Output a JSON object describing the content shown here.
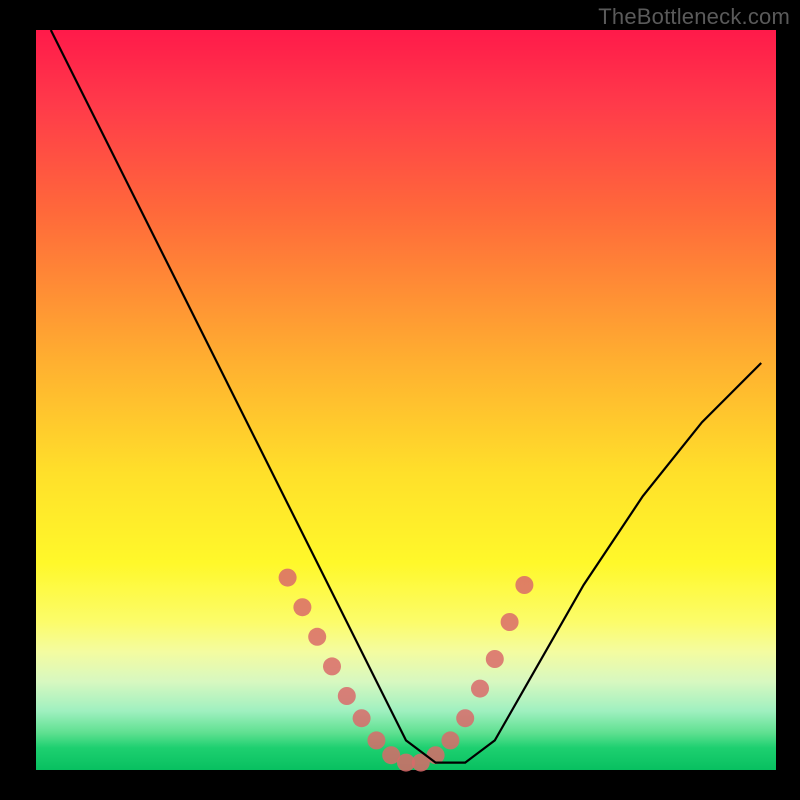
{
  "watermark": "TheBottleneck.com",
  "chart_data": {
    "type": "line",
    "title": "",
    "xlabel": "",
    "ylabel": "",
    "xlim": [
      0,
      100
    ],
    "ylim": [
      0,
      100
    ],
    "grid": false,
    "legend": false,
    "background_gradient": [
      "#ff1a4a",
      "#ffe02a",
      "#08c060"
    ],
    "series": [
      {
        "name": "bottleneck-curve",
        "color": "#000000",
        "x": [
          2,
          6,
          10,
          14,
          18,
          22,
          26,
          30,
          34,
          38,
          42,
          46,
          50,
          54,
          58,
          62,
          66,
          70,
          74,
          78,
          82,
          86,
          90,
          94,
          98
        ],
        "values": [
          100,
          92,
          84,
          76,
          68,
          60,
          52,
          44,
          36,
          28,
          20,
          12,
          4,
          1,
          1,
          4,
          11,
          18,
          25,
          31,
          37,
          42,
          47,
          51,
          55
        ]
      }
    ],
    "markers": {
      "name": "highlight-dots",
      "color": "#d96a6a",
      "radius": 9,
      "x": [
        34,
        36,
        38,
        40,
        42,
        44,
        46,
        48,
        50,
        52,
        54,
        56,
        58,
        60,
        62,
        64,
        66
      ],
      "values": [
        26,
        22,
        18,
        14,
        10,
        7,
        4,
        2,
        1,
        1,
        2,
        4,
        7,
        11,
        15,
        20,
        25
      ]
    }
  }
}
